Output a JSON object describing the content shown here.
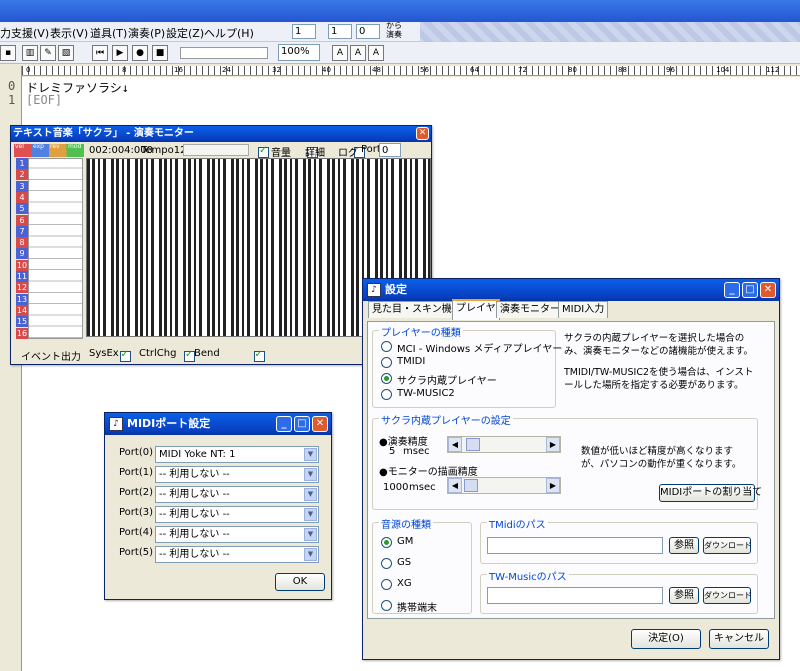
{
  "menu": {
    "items": [
      "力支援(V)",
      "表示(V)",
      "道具(T)",
      "演奏(P)",
      "設定(Z)",
      "ヘルプ(H)"
    ]
  },
  "toolbar": {
    "spin1": "1",
    "spin2": "1",
    "spin3": "0",
    "spin_suffix": "から\n演奏",
    "zoom": "100%",
    "prefix_label": "ll"
  },
  "ruler": {
    "marks": [
      "0",
      "8",
      "16",
      "24",
      "32",
      "40",
      "48",
      "56",
      "64",
      "72",
      "80",
      "88",
      "96",
      "104",
      "112"
    ]
  },
  "editor": {
    "lines": [
      {
        "num": "0",
        "text": "ドレミファソラシ↓"
      },
      {
        "num": "1",
        "text": "[EOF]"
      }
    ]
  },
  "monitor": {
    "title": "テキスト音楽「サクラ」 - 演奏モニター",
    "headers": [
      "vel",
      "exp",
      "rev",
      "mod"
    ],
    "time": "002:004:000",
    "tempo": "Tempo120",
    "sound_label": "音量",
    "detail_label": "詳細",
    "log_label": "ログ",
    "port_label": "Port",
    "port_value": "0",
    "channels": [
      "1",
      "2",
      "3",
      "4",
      "5",
      "6",
      "7",
      "8",
      "9",
      "10",
      "11",
      "12",
      "13",
      "14",
      "15",
      "16"
    ],
    "event_output": "イベント出力",
    "sysex": "SysEx",
    "ctrlchg": "CtrlChg",
    "bend": "Bend"
  },
  "midi_ports": {
    "title": "MIDIポート設定",
    "ports": [
      {
        "label": "Port(0)",
        "value": "MIDI Yoke NT: 1"
      },
      {
        "label": "Port(1)",
        "value": "-- 利用しない --"
      },
      {
        "label": "Port(2)",
        "value": "-- 利用しない --"
      },
      {
        "label": "Port(3)",
        "value": "-- 利用しない --"
      },
      {
        "label": "Port(4)",
        "value": "-- 利用しない --"
      },
      {
        "label": "Port(5)",
        "value": "-- 利用しない --"
      }
    ],
    "ok": "OK"
  },
  "settings": {
    "title": "設定",
    "tabs": [
      "見た目・スキン機能",
      "プレイヤ",
      "演奏モニター",
      "MIDI入力"
    ],
    "player_type_title": "プレイヤーの種類",
    "player_types": [
      "MCI - Windows メディアプレイヤー",
      "TMIDI",
      "サクラ内蔵プレイヤー",
      "TW-MUSIC2"
    ],
    "player_note1": "サクラの内蔵プレイヤーを選択した場合のみ、演奏モニターなどの諸機能が使えます。",
    "player_note2": "TMIDI/TW-MUSIC2を使う場合は、インストールした場所を指定する必要があります。",
    "internal_title": "サクラ内蔵プレイヤーの設定",
    "precision_label": "●演奏精度",
    "precision_value": "5",
    "monitor_precision_label": "●モニターの描画精度",
    "monitor_value": "1000",
    "msec": "msec",
    "precision_note": "数値が低いほど精度が高くなりますが、パソコンの動作が重くなります。",
    "assign_button": "MIDIポートの割り当て",
    "source_title": "音源の種類",
    "sources": [
      "GM",
      "GS",
      "XG",
      "携帯端末"
    ],
    "tmidi_title": "TMidiのパス",
    "twmusic_title": "TW-Musicのパス",
    "browse": "参照",
    "download": "ダウンロード",
    "ok": "決定(O)",
    "cancel": "キャンセル"
  },
  "colors": {
    "title_blue": "#0a5fe8",
    "accent_green": "#2a9a2a",
    "group_title": "#0046d5"
  }
}
